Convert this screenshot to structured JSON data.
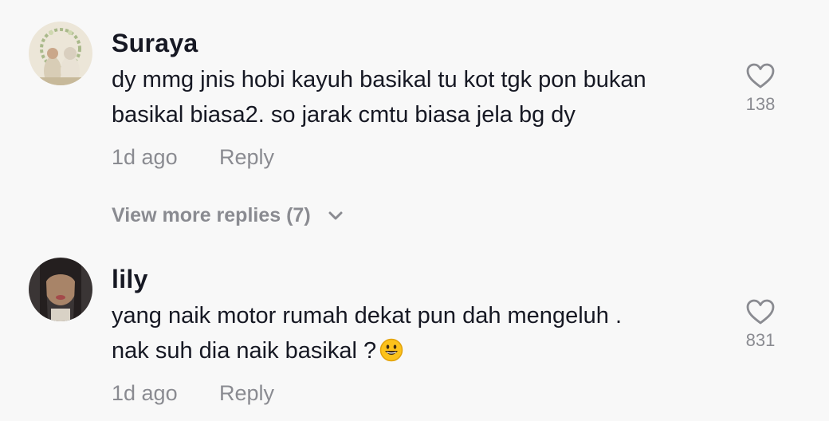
{
  "comments": [
    {
      "username": "Suraya",
      "text_lines": [
        "dy mmg jnis hobi kayuh basikal tu kot tgk pon bukan",
        "basikal biasa2. so jarak cmtu biasa jela bg dy"
      ],
      "time": "1d ago",
      "reply_label": "Reply",
      "likes": "138",
      "view_more": "View more replies (7)"
    },
    {
      "username": "lily",
      "text_lines": [
        "yang naik motor rumah dekat pun dah mengeluh .",
        "nak suh dia naik basikal ?"
      ],
      "time": "1d ago",
      "reply_label": "Reply",
      "likes": "831"
    }
  ],
  "icons": {
    "like": "heart-outline-icon",
    "expand": "chevron-down-icon",
    "emoji": "grinning-face-emoji"
  },
  "colors": {
    "background": "#f8f8f8",
    "primary_text": "#161823",
    "secondary_text": "#8a8b91"
  }
}
